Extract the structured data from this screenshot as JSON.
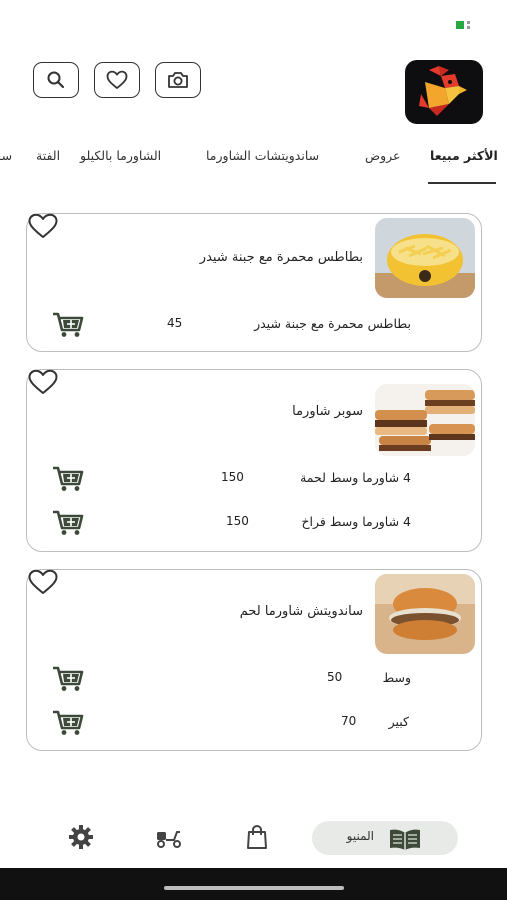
{
  "app": {
    "accent": "#3d4a3a",
    "brand_red": "#e33a2c",
    "brand_yellow": "#f3b42c"
  },
  "header": {
    "icons": [
      "search-icon",
      "heart-icon",
      "camera-icon"
    ]
  },
  "tabs": [
    {
      "label": "الأكثر مبيعا",
      "active": true
    },
    {
      "label": "عروض",
      "active": false
    },
    {
      "label": "ساندويتشات الشاورما",
      "active": false
    },
    {
      "label": "الشاورما بالكيلو",
      "active": false
    },
    {
      "label": "الفتة",
      "active": false
    },
    {
      "label": "سـ",
      "active": false
    }
  ],
  "products": [
    {
      "title": "بطاطس محمرة مع جبنة شيدر",
      "variants": [
        {
          "name": "بطاطس محمرة مع جبنة شيدر",
          "price": "45"
        }
      ]
    },
    {
      "title": "سوبر شاورما",
      "variants": [
        {
          "name": "4 شاورما وسط لحمة",
          "price": "150"
        },
        {
          "name": "4 شاورما وسط فراخ",
          "price": "150"
        }
      ]
    },
    {
      "title": "ساندويتش شاورما لحم",
      "variants": [
        {
          "name": "وسط",
          "price": "50"
        },
        {
          "name": "كبير",
          "price": "70"
        }
      ]
    }
  ],
  "bottom_nav": {
    "menu_label": "المنيو",
    "items": [
      "menu-book-icon",
      "shopping-bag-icon",
      "delivery-scooter-icon",
      "settings-gear-icon"
    ]
  }
}
